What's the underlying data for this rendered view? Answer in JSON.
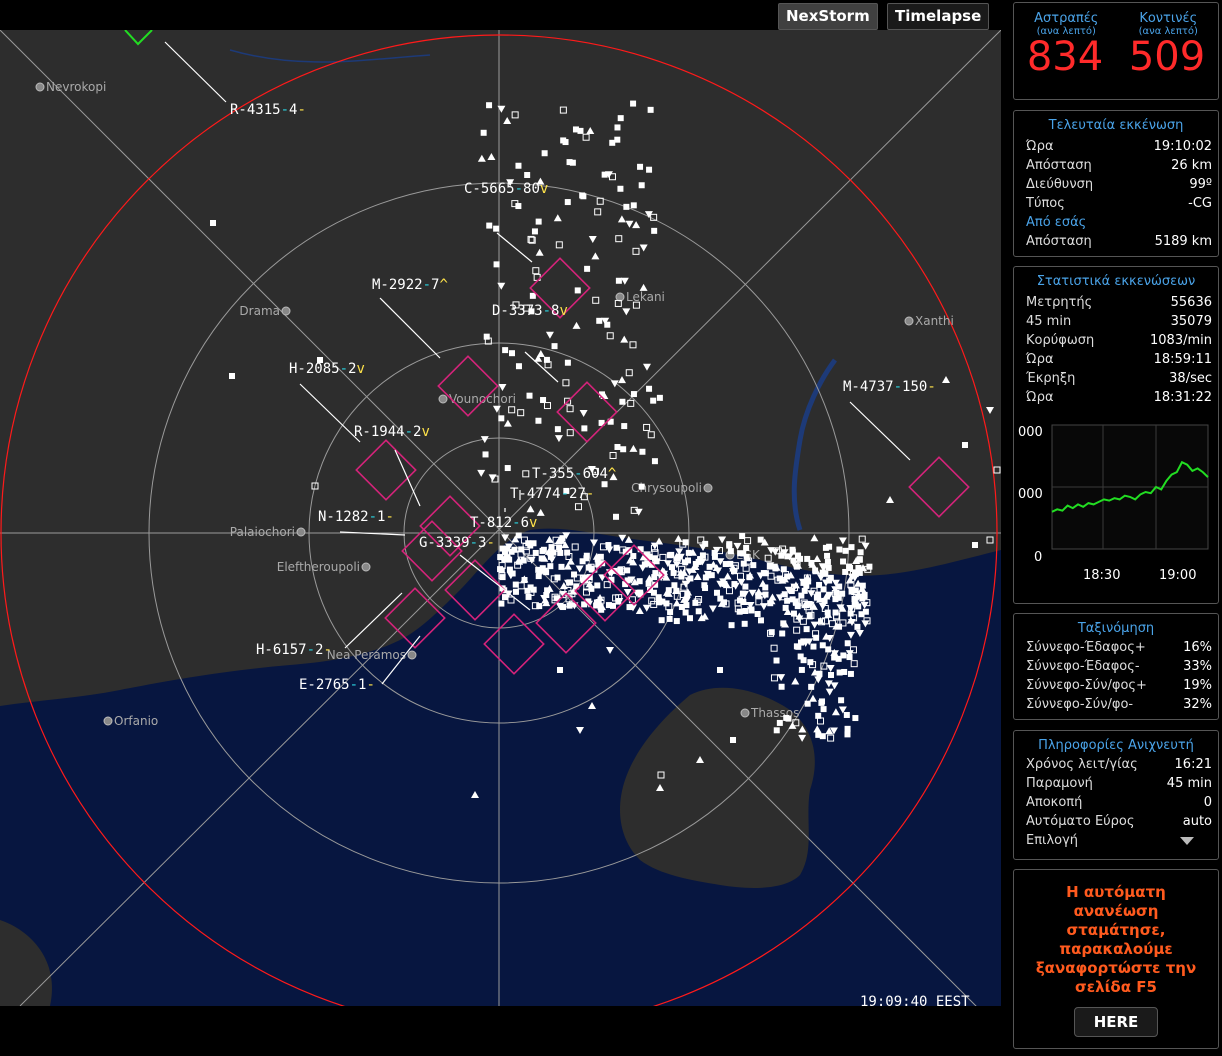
{
  "tabs": {
    "nexstorm": "NexStorm",
    "timelapse": "Timelapse"
  },
  "map_time": "19:09:40 EEST",
  "cities": [
    {
      "name": "Nevrokopi"
    },
    {
      "name": "Drama"
    },
    {
      "name": "Vounochori"
    },
    {
      "name": "Palaiochori"
    },
    {
      "name": "Eleftheroupoli"
    },
    {
      "name": "Nea Peramos"
    },
    {
      "name": "Orfanio"
    },
    {
      "name": "Lekani"
    },
    {
      "name": "Xanthi"
    },
    {
      "name": "Chrysoupoli"
    },
    {
      "name": "LGK"
    },
    {
      "name": "Thassos"
    }
  ],
  "storm_labels": [
    {
      "id": "R-4315",
      "a": "4",
      "b": "-"
    },
    {
      "id": "C-5665",
      "a": "80",
      "b": "v"
    },
    {
      "id": "M-2922",
      "a": "7",
      "b": "^"
    },
    {
      "id": "D-3373",
      "a": "8",
      "b": "v"
    },
    {
      "id": "H-2085",
      "a": "2",
      "b": "v"
    },
    {
      "id": "R-1944",
      "a": "2",
      "b": "v"
    },
    {
      "id": "N-1282",
      "a": "1",
      "b": "-"
    },
    {
      "id": "G-3339",
      "a": "3",
      "b": "-"
    },
    {
      "id": "H-6157",
      "a": "2",
      "b": "-"
    },
    {
      "id": "E-2765",
      "a": "1",
      "b": "-"
    },
    {
      "id": "M-4737",
      "a": "150",
      "b": "-"
    },
    {
      "id": "T-355",
      "a": "604",
      "b": "^"
    },
    {
      "id": "T-4774",
      "a": "27",
      "b": "-"
    },
    {
      "id": "T-812",
      "a": "6",
      "b": "v"
    }
  ],
  "strike_counts": {
    "strikes_label": "Αστραπές",
    "strikes_sub": "(ανα λεπτό)",
    "near_label": "Κοντινές",
    "near_sub": "(ανα λεπτό)",
    "strikes_value": "834",
    "near_value": "509"
  },
  "last_discharge": {
    "title": "Τελευταία εκκένωση",
    "rows": [
      {
        "k": "Ώρα",
        "v": "19:10:02"
      },
      {
        "k": "Απόσταση",
        "v": "26 km"
      },
      {
        "k": "Διεύθυνση",
        "v": "99º"
      },
      {
        "k": "Τύπος",
        "v": "-CG"
      }
    ],
    "from_you": "Από εσάς",
    "from_row": {
      "k": "Απόσταση",
      "v": "5189 km"
    }
  },
  "discharge_stats": {
    "title": "Στατιστικά εκκενώσεων",
    "rows": [
      {
        "k": "Μετρητής",
        "v": "55636"
      },
      {
        "k": "45 min",
        "v": "35079"
      },
      {
        "k": "Κορύφωση",
        "v": "1083/min"
      },
      {
        "k": "Ώρα",
        "v": "18:59:11"
      },
      {
        "k": "Έκρηξη",
        "v": "38/sec"
      },
      {
        "k": "Ώρα",
        "v": "18:31:22"
      }
    ]
  },
  "rate_chart": {
    "y_labels": [
      "000",
      "000",
      "0"
    ],
    "x_labels": [
      "18:30",
      "19:00"
    ],
    "line_color": "#22dd22",
    "values": [
      0.3,
      0.32,
      0.31,
      0.35,
      0.33,
      0.36,
      0.34,
      0.37,
      0.36,
      0.38,
      0.4,
      0.39,
      0.41,
      0.4,
      0.43,
      0.42,
      0.4,
      0.44,
      0.46,
      0.45,
      0.5,
      0.48,
      0.55,
      0.6,
      0.62,
      0.7,
      0.68,
      0.63,
      0.65,
      0.62,
      0.58
    ]
  },
  "classification": {
    "title": "Ταξινόμηση",
    "rows": [
      {
        "k": "Σύννεφο-Έδαφος+",
        "v": "16%"
      },
      {
        "k": "Σύννεφο-Έδαφος-",
        "v": "33%"
      },
      {
        "k": "Σύννεφο-Σύν/φος+",
        "v": "19%"
      },
      {
        "k": "Σύννεφο-Σύν/φο-",
        "v": "32%"
      }
    ]
  },
  "detector_info": {
    "title": "Πληροφορίες Ανιχνευτή",
    "rows": [
      {
        "k": "Χρόνος λειτ/γίας",
        "v": "16:21"
      },
      {
        "k": "Παραμονή",
        "v": "45 min"
      },
      {
        "k": "Αποκοπή",
        "v": "0"
      },
      {
        "k": "Αυτόματο Εύρος",
        "v": "auto"
      }
    ],
    "select_label": "Επιλογή"
  },
  "notice": {
    "text": "Η αυτόματη ανανέωση σταμάτησε, παρακαλούμε ξαναφορτώστε την σελίδα F5",
    "button": "HERE"
  },
  "colors": {
    "accent_blue": "#4aa3e8",
    "count_red": "#ff2a2a",
    "notice_orange": "#ff5a1e",
    "range_ring": "#ff1a1a",
    "cell_box": "#d4237a",
    "sea": "#071640",
    "land": "#2d2d2d"
  }
}
